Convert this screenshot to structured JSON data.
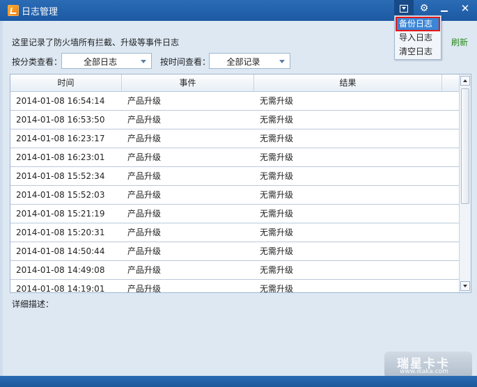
{
  "window": {
    "title": "日志管理"
  },
  "menu": {
    "items": [
      "备份日志",
      "导入日志",
      "清空日志"
    ],
    "selected_index": 0
  },
  "header": {
    "description": "这里记录了防火墙所有拦截、升级等事件日志",
    "refresh_label": "刷新"
  },
  "filters": {
    "category_label": "按分类查看：",
    "category_value": "全部日志",
    "time_label": "按时间查看：",
    "time_value": "全部记录"
  },
  "table": {
    "columns": [
      "时间",
      "事件",
      "结果"
    ],
    "rows": [
      [
        "2014-01-08 16:54:14",
        "产品升级",
        "无需升级"
      ],
      [
        "2014-01-08 16:53:50",
        "产品升级",
        "无需升级"
      ],
      [
        "2014-01-08 16:23:17",
        "产品升级",
        "无需升级"
      ],
      [
        "2014-01-08 16:23:01",
        "产品升级",
        "无需升级"
      ],
      [
        "2014-01-08 15:52:34",
        "产品升级",
        "无需升级"
      ],
      [
        "2014-01-08 15:52:03",
        "产品升级",
        "无需升级"
      ],
      [
        "2014-01-08 15:21:19",
        "产品升级",
        "无需升级"
      ],
      [
        "2014-01-08 15:20:31",
        "产品升级",
        "无需升级"
      ],
      [
        "2014-01-08 14:50:44",
        "产品升级",
        "无需升级"
      ],
      [
        "2014-01-08 14:49:08",
        "产品升级",
        "无需升级"
      ],
      [
        "2014-01-08 14:19:01",
        "产品升级",
        "无需升级"
      ]
    ]
  },
  "detail": {
    "label": "详细描述："
  },
  "watermark": {
    "brand": "瑞星卡卡",
    "url": "www.ikaka.com"
  },
  "colors": {
    "titlebar": "#1c59a3",
    "menu_highlight": "#3b86d6",
    "menu_outline": "#e41818",
    "refresh": "#2b8a1b"
  },
  "icons": [
    "app-logo-icon",
    "dropdown-menu-icon",
    "gear-icon",
    "minimize-icon",
    "close-icon"
  ]
}
